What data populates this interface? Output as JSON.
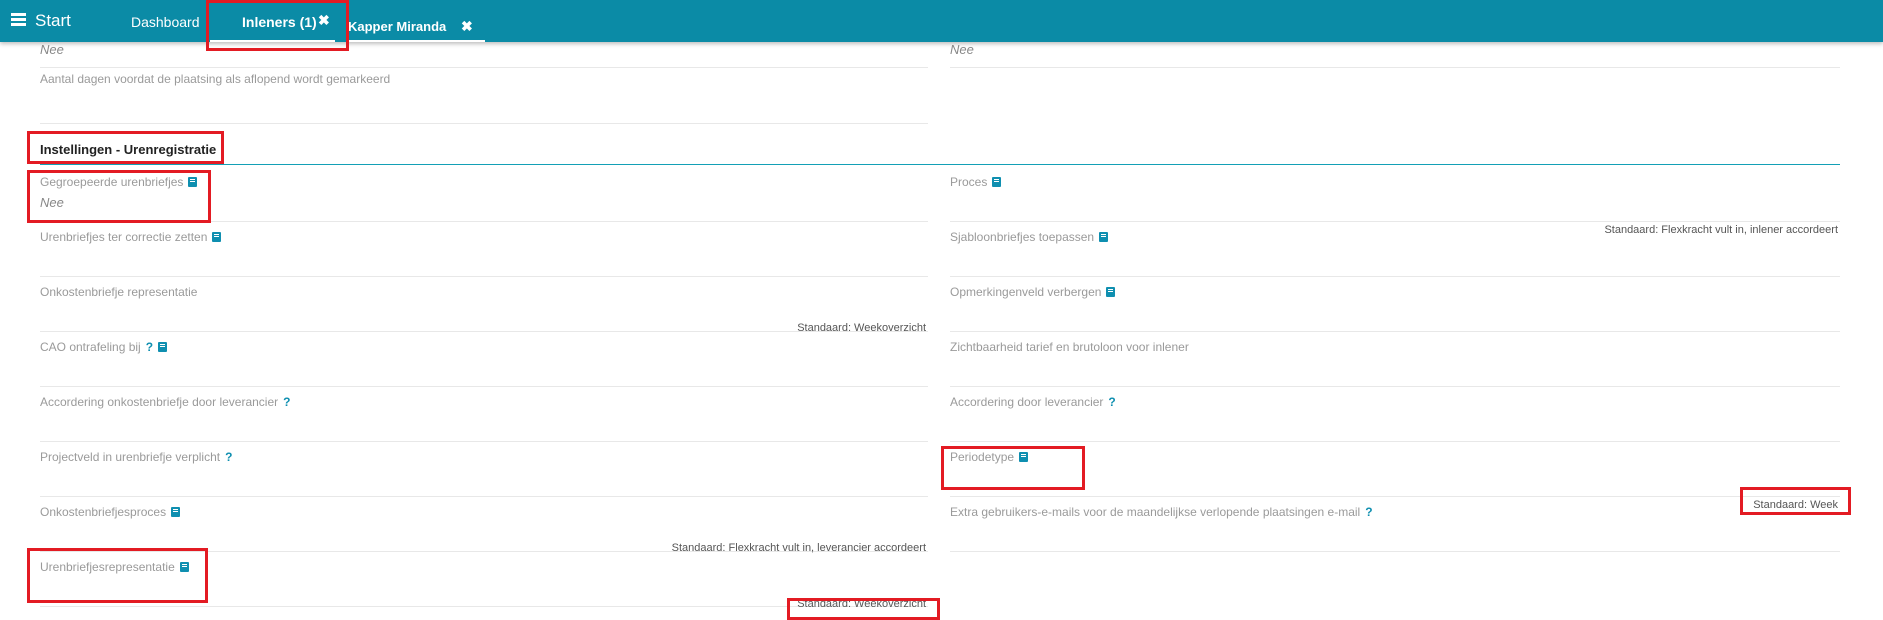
{
  "topbar": {
    "start_label": "Start",
    "tabs": [
      {
        "label": "Dashboard"
      },
      {
        "label": "Inleners (1)",
        "close": "✖"
      },
      {
        "label": "Kapper Miranda",
        "close": "✖"
      }
    ]
  },
  "top_rows": {
    "left_value": "Nee",
    "right_value": "Nee",
    "left_label": "Aantal dagen voordat de plaatsing als aflopend wordt gemarkeerd"
  },
  "section": {
    "title": "Instellingen - Urenregistratie"
  },
  "left_fields": [
    {
      "label": "Gegroepeerde urenbriefjes",
      "value": "Nee"
    },
    {
      "label": "Urenbriefjes ter correctie zetten"
    },
    {
      "label": "Onkostenbriefje representatie",
      "default": "Standaard: Weekoverzicht"
    },
    {
      "label": "CAO ontrafeling bij",
      "help": "?"
    },
    {
      "label": "Accordering onkostenbriefje door leverancier",
      "help": "?"
    },
    {
      "label": "Projectveld in urenbriefje verplicht",
      "help": "?"
    },
    {
      "label": "Onkostenbriefjesproces",
      "default": "Standaard: Flexkracht vult in, leverancier accordeert"
    },
    {
      "label": "Urenbriefjesrepresentatie",
      "default": "Standaard: Weekoverzicht"
    }
  ],
  "right_fields": [
    {
      "label": "Proces",
      "default": "Standaard: Flexkracht vult in, inlener accordeert"
    },
    {
      "label": "Sjabloonbriefjes toepassen"
    },
    {
      "label": "Opmerkingenveld verbergen"
    },
    {
      "label": "Zichtbaarheid tarief en brutoloon voor inlener"
    },
    {
      "label": "Accordering door leverancier",
      "help": "?"
    },
    {
      "label": "Periodetype",
      "default": "Standaard: Week"
    },
    {
      "label": "Extra gebruikers-e-mails voor de maandelijkse verlopende plaatsingen e-mail",
      "help": "?"
    }
  ],
  "colors": {
    "topbar": "#0b8ba6",
    "accent": "#0f8fb0",
    "highlight": "#e31b23"
  }
}
